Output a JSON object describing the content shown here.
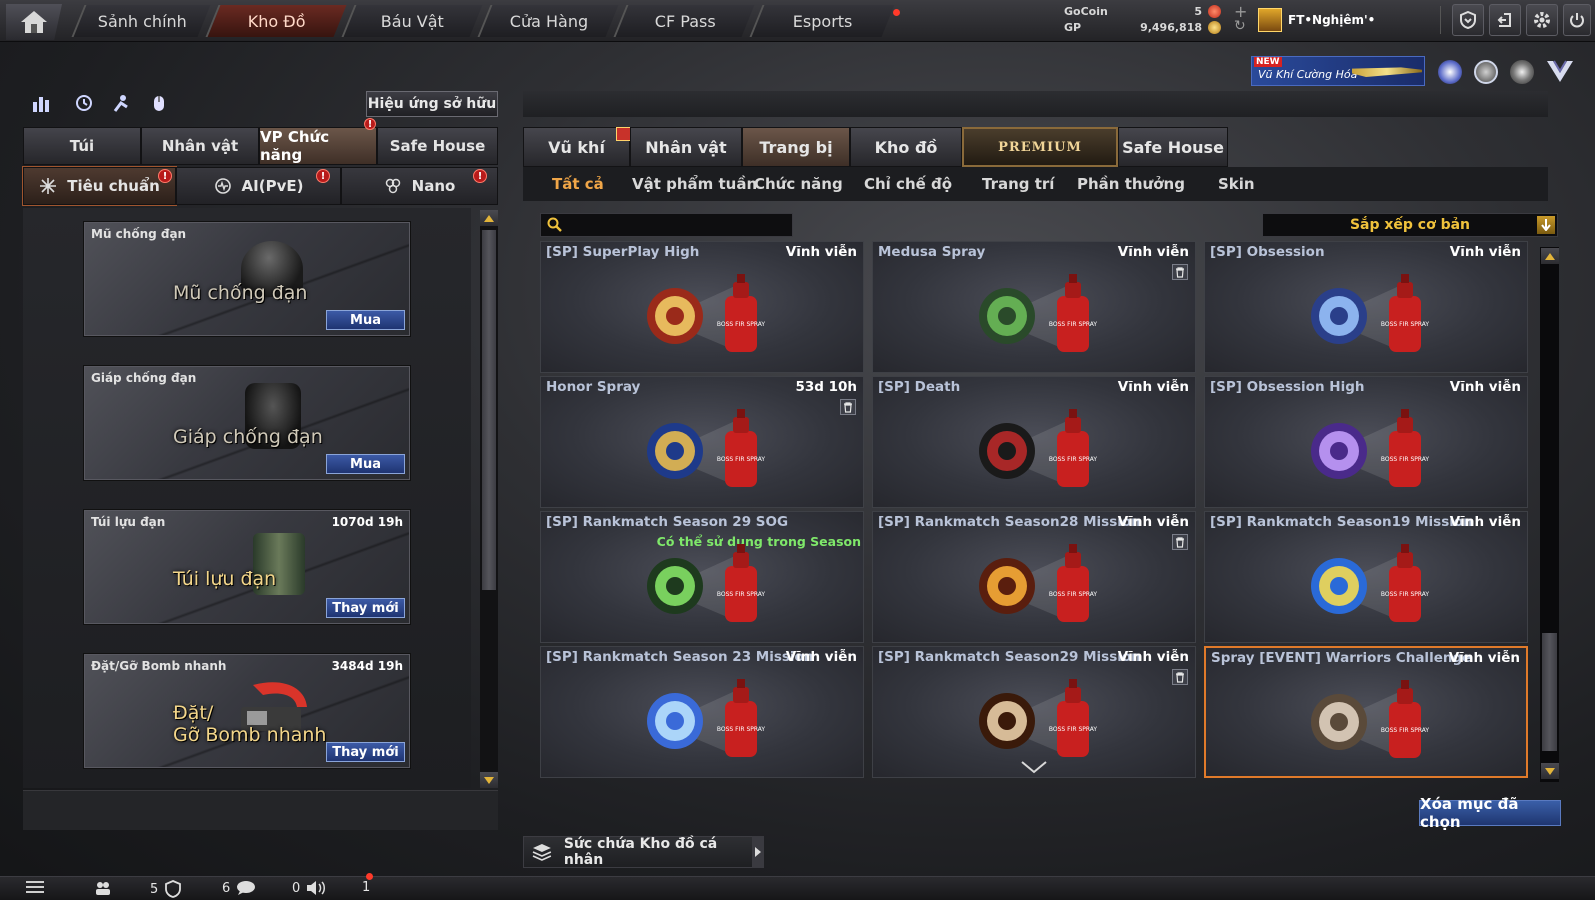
{
  "nav": {
    "tabs": [
      "Sảnh chính",
      "Kho Đồ",
      "Báu Vật",
      "Cửa Hàng",
      "CF Pass",
      "Esports"
    ],
    "active_tab": "Kho Đồ"
  },
  "currency": {
    "gocoin_label": "GoCoin",
    "gocoin_value": "5",
    "gp_label": "GP",
    "gp_value": "9,496,818"
  },
  "player": {
    "name": "FT•Nghịêm'•"
  },
  "promo": {
    "badge": "NEW",
    "text": "Vũ Khí Cường Hóa"
  },
  "left": {
    "owned_effects_button": "Hiệu ứng sở hữu",
    "tabs": [
      "Túi",
      "Nhân vật",
      "VP Chức năng",
      "Safe House"
    ],
    "active_tab": "VP Chức năng",
    "subtabs": [
      "Tiêu chuẩn",
      "AI(PvE)",
      "Nano"
    ],
    "active_subtab": "Tiêu chuẩn",
    "items": [
      {
        "name": "Mũ chống đạn",
        "overlay": "Mũ chống đạn",
        "time": "",
        "action": "Mua"
      },
      {
        "name": "Giáp chống đạn",
        "overlay": "Giáp chống đạn",
        "time": "",
        "action": "Mua"
      },
      {
        "name": "Túi lựu đạn",
        "overlay": "Túi lựu đạn",
        "time": "1070d 19h",
        "action": "Thay mới"
      },
      {
        "name": "Đặt/Gỡ Bomb nhanh",
        "overlay_line1": "Đặt/",
        "overlay_line2": "Gỡ Bomb nhanh",
        "time": "3484d 19h",
        "action": "Thay mới"
      }
    ]
  },
  "right": {
    "tabs": [
      "Vũ khí",
      "Nhân vật",
      "Trang bị",
      "Kho đồ",
      "PREMIUM",
      "Safe House"
    ],
    "active_tab": "Trang bị",
    "subtabs": [
      "Tất cả",
      "Vật phẩm tuần",
      "Chức năng",
      "Chỉ chế độ",
      "Trang trí",
      "Phần thưởng",
      "Skin"
    ],
    "active_subtab": "Tất cả",
    "search_placeholder": "",
    "sort_label": "Sắp xếp cơ bản",
    "items": [
      {
        "name": "[SP] SuperPlay High",
        "time": "Vĩnh viễn",
        "icon": "gold-trophy-emblem"
      },
      {
        "name": "Medusa Spray",
        "time": "Vĩnh viễn",
        "icon": "medusa-emblem"
      },
      {
        "name": "[SP] Obsession",
        "time": "Vĩnh viễn",
        "icon": "blue-winged-emblem"
      },
      {
        "name": "Honor Spray",
        "time": "53d 10h",
        "icon": "honor-ring-emblem"
      },
      {
        "name": "[SP] Death",
        "time": "Vĩnh viễn",
        "icon": "hooded-death-emblem"
      },
      {
        "name": "[SP] Obsession High",
        "time": "Vĩnh viễn",
        "icon": "purple-winged-emblem"
      },
      {
        "name": "[SP] Rankmatch Season 29 SOG",
        "time": "",
        "note": "Có thể sử dụng trong Season",
        "icon": "green-rank-emblem"
      },
      {
        "name": "[SP] Rankmatch Season28 Mission",
        "time": "Vĩnh viễn",
        "icon": "phoenix-28-emblem"
      },
      {
        "name": "[SP] Rankmatch Season19 Mission",
        "time": "Vĩnh viễn",
        "icon": "season-19-emblem"
      },
      {
        "name": "[SP] Rankmatch Season 23 Mission",
        "time": "Vĩnh viễn",
        "icon": "diamond-23-emblem"
      },
      {
        "name": "[SP] Rankmatch Season29 Mission",
        "time": "Vĩnh viễn",
        "icon": "season-29-emblem"
      },
      {
        "name": "Spray [EVENT] Warriors Challenge",
        "time": "Vĩnh viễn",
        "icon": "chibi-soldier-emblem"
      }
    ],
    "spray_can_text": "BOSS FIR SPRAY",
    "delete_button": "Xóa mục đã chọn",
    "capacity_label": "Sức chứa Kho đồ cá nhân"
  },
  "bottom": {
    "friends_count": "5",
    "clan_count": "6",
    "chat_count": "0",
    "voice_count": "1"
  },
  "colors": {
    "active_orange": "#f0a648",
    "gold_text": "#f0c23c",
    "button_blue": "#2c4a8e",
    "season_note_green": "#7fe86a",
    "selected_border": "#e07a2a",
    "alert_red": "#ff3a2a"
  }
}
